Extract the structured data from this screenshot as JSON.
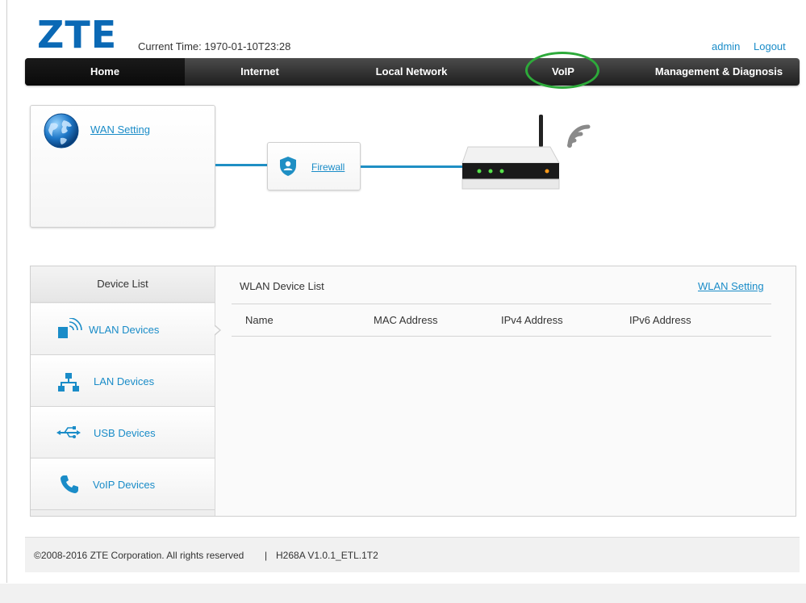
{
  "header": {
    "logo": "ZTE",
    "current_time": "Current Time: 1970-01-10T23:28",
    "admin": "admin",
    "logout": "Logout"
  },
  "nav": [
    {
      "label": "Home",
      "active": true
    },
    {
      "label": "Internet",
      "active": false
    },
    {
      "label": "Local Network",
      "active": false
    },
    {
      "label": "VoIP",
      "active": false
    },
    {
      "label": "Management & Diagnosis",
      "active": false
    }
  ],
  "topology": {
    "wan_setting": "WAN Setting",
    "firewall": "Firewall"
  },
  "device_list": {
    "title": "Device List",
    "items": [
      {
        "label": "WLAN Devices",
        "icon": "wlan-device-icon"
      },
      {
        "label": "LAN Devices",
        "icon": "lan-network-icon"
      },
      {
        "label": "USB Devices",
        "icon": "usb-icon"
      },
      {
        "label": "VoIP Devices",
        "icon": "phone-icon"
      }
    ]
  },
  "wlan_panel": {
    "title": "WLAN Device List",
    "setting_link": "WLAN Setting",
    "columns": [
      "Name",
      "MAC Address",
      "IPv4 Address",
      "IPv6 Address"
    ]
  },
  "footer": {
    "copyright": "©2008-2016 ZTE Corporation. All rights reserved",
    "separator": "|",
    "version": "H268A V1.0.1_ETL.1T2"
  },
  "colors": {
    "brand": "#0b69b5",
    "link": "#1a8cc8",
    "annotation_circle": "#2daa3a"
  }
}
